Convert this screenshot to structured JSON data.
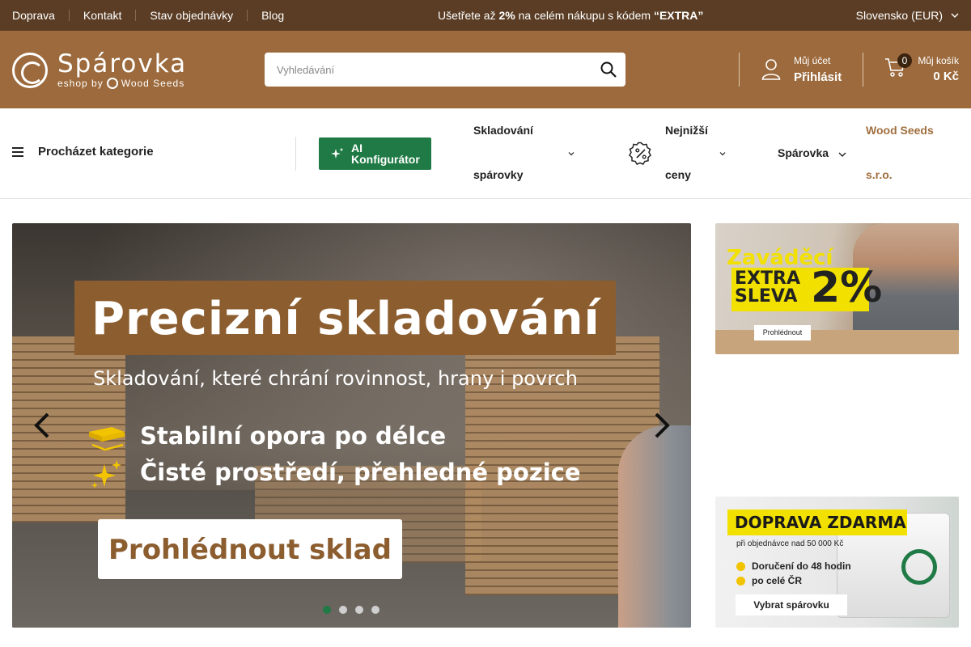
{
  "topbar": {
    "links": [
      "Doprava",
      "Kontakt",
      "Stav objednávky",
      "Blog"
    ],
    "promo_before": "Ušetřete až ",
    "promo_pct": "2%",
    "promo_mid": " na celém nákupu s kódem ",
    "promo_code": "“EXTRA”",
    "language": "Slovensko (EUR)"
  },
  "header": {
    "logo_title": "Spárovka",
    "logo_sub": "eshop by",
    "logo_brand": "Wood Seeds",
    "search_placeholder": "Vyhledávání",
    "account_small": "Můj účet",
    "account_big": "Přihlásit",
    "cart_count": "0",
    "cart_small": "Můj košík",
    "cart_total": "0 Kč"
  },
  "nav": {
    "browse_label": "Procházet kategorie",
    "ai_label": "AI Konfigurátor",
    "items": [
      {
        "label_line1": "Skladování",
        "label_line2": "spárovky"
      },
      {
        "label_line1": "Nejnižší",
        "label_line2": "ceny"
      },
      {
        "label_line1": "Spárovka"
      },
      {
        "label_line1": "Wood Seeds",
        "label_line2": "s.r.o."
      }
    ]
  },
  "hero": {
    "title": "Precizní skladování",
    "subtitle": "Skladování, které chrání rovinnost, hrany i povrch",
    "features": [
      "Stabilní opora po délce",
      "Čisté prostředí, přehledné pozice"
    ],
    "cta": "Prohlédnout sklad",
    "slides_total": 4,
    "slide_active": 1
  },
  "banners": {
    "promo": {
      "line1": "Zaváděcí",
      "line2": "EXTRA SLEVA",
      "pct": "2%",
      "button": "Prohlédnout"
    },
    "shipping": {
      "title": "DOPRAVA ZDARMA",
      "sub": "při objednávce nad 50 000 Kč",
      "items": [
        "Doručení do 48 hodin",
        "po celé ČR"
      ],
      "button": "Vybrat spárovku"
    }
  },
  "colors": {
    "topbar": "#5a3d24",
    "header": "#9c6a3c",
    "accent_green": "#1f7a45",
    "wood_link": "#a06e3e"
  }
}
